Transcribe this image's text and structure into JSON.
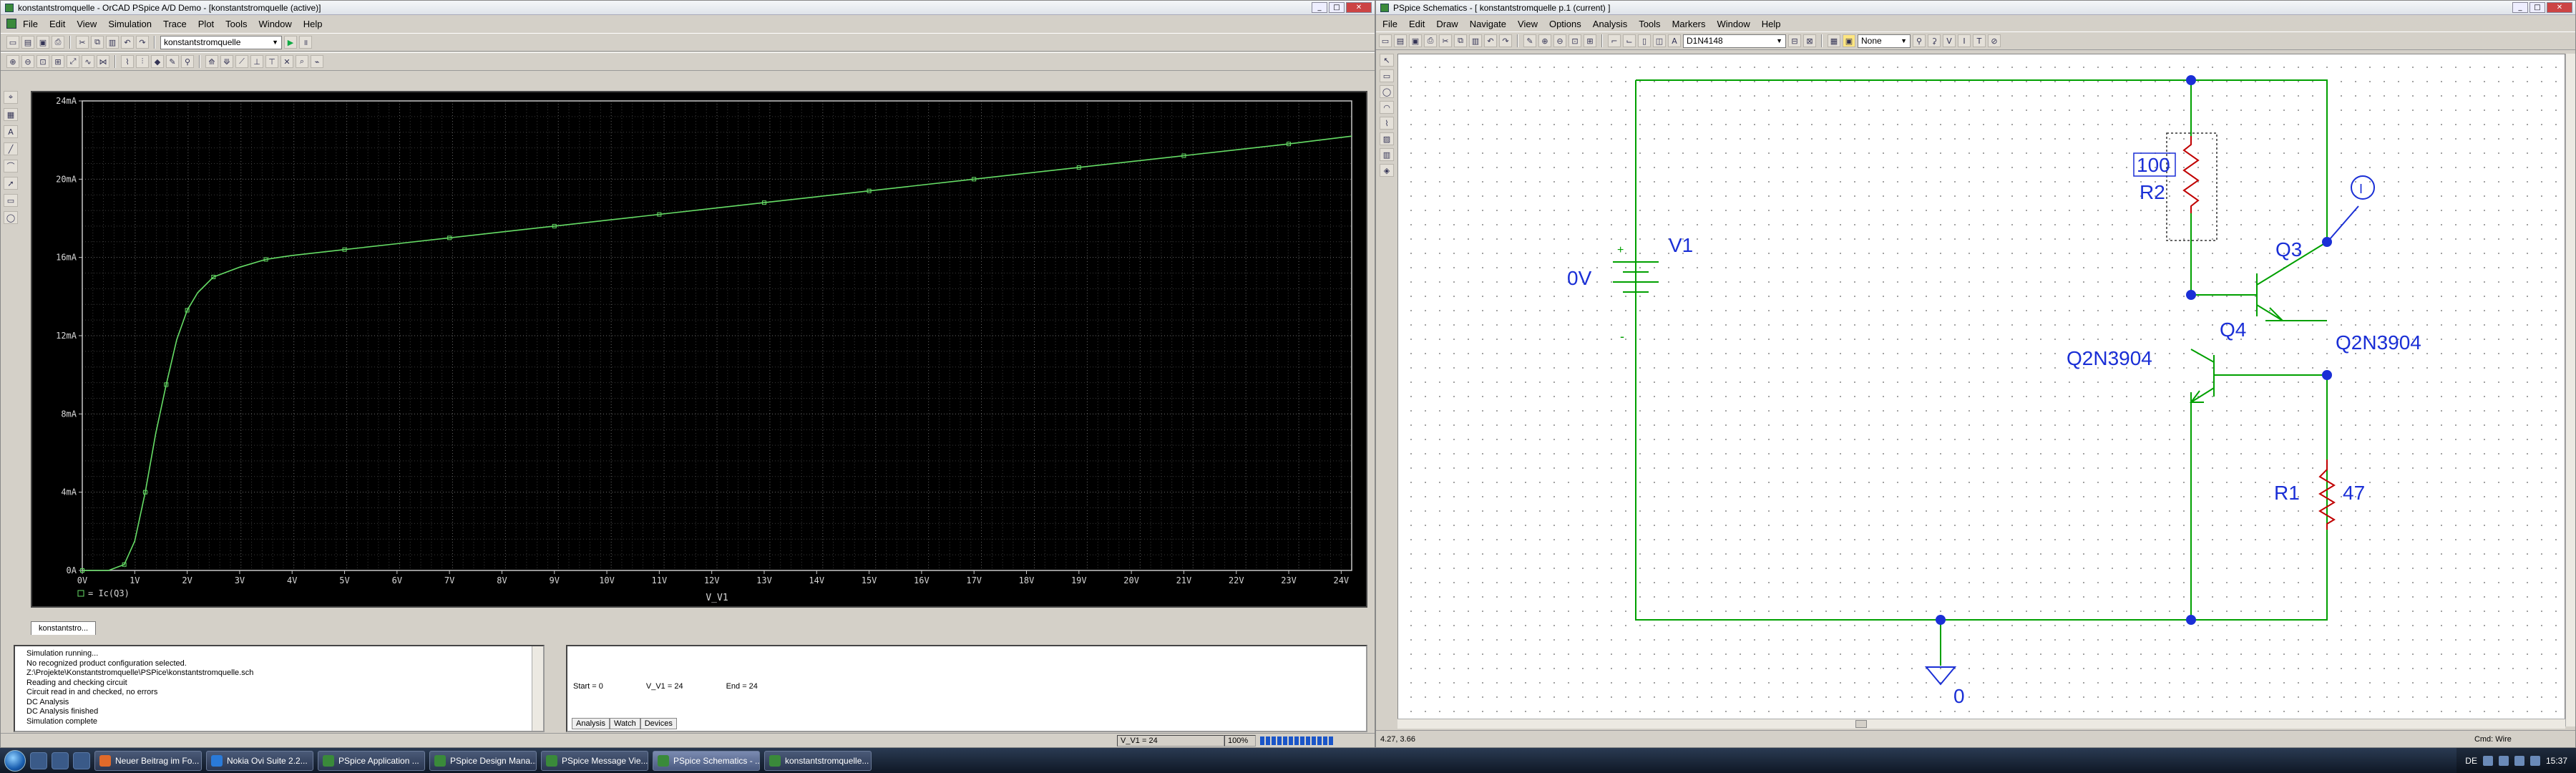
{
  "probe": {
    "title": "konstantstromquelle - OrCAD PSpice A/D Demo - [konstantstromquelle (active)]",
    "menu": [
      "File",
      "Edit",
      "View",
      "Simulation",
      "Trace",
      "Plot",
      "Tools",
      "Window",
      "Help"
    ],
    "profile_value": "konstantstromquelle",
    "doc_tab": "konstantstro...",
    "output_lines": [
      "Simulation running...",
      "No recognized product configuration selected.",
      "Z:\\Projekte\\Konstantstromquelle\\PSPice\\konstantstromquelle.sch",
      "Reading and checking circuit",
      "Circuit read in and checked, no errors",
      "DC Analysis",
      "DC Analysis finished",
      "Simulation complete"
    ],
    "sim": {
      "start": "Start = 0",
      "var": "V_V1 = 24",
      "end": "End = 24"
    },
    "sim_tabs": [
      "Analysis",
      "Watch",
      "Devices"
    ],
    "status_var": "V_V1 = 24",
    "status_zoom": "100%"
  },
  "chart_data": {
    "type": "line",
    "title": "",
    "xlabel": "V_V1",
    "ylabel": "",
    "x_tick_labels": [
      "0V",
      "1V",
      "2V",
      "3V",
      "4V",
      "5V",
      "6V",
      "7V",
      "8V",
      "9V",
      "10V",
      "11V",
      "12V",
      "13V",
      "14V",
      "15V",
      "16V",
      "17V",
      "18V",
      "19V",
      "20V",
      "21V",
      "22V",
      "23V",
      "24V"
    ],
    "y_tick_labels": [
      "0A",
      "4mA",
      "8mA",
      "12mA",
      "16mA",
      "20mA",
      "24mA"
    ],
    "xlim": [
      0,
      24.2
    ],
    "ylim": [
      0,
      0.024
    ],
    "grid": true,
    "series": [
      {
        "name": "Ic(Q3)",
        "color": "#66dd66",
        "x": [
          0,
          0.5,
          0.8,
          1.0,
          1.2,
          1.4,
          1.6,
          1.8,
          2.0,
          2.2,
          2.5,
          3.0,
          3.5,
          4,
          5,
          6,
          7,
          8,
          9,
          10,
          11,
          12,
          13,
          14,
          15,
          16,
          17,
          18,
          19,
          20,
          21,
          22,
          23,
          24.2
        ],
        "y": [
          0,
          0,
          0.0003,
          0.0015,
          0.004,
          0.007,
          0.0095,
          0.0118,
          0.0133,
          0.0142,
          0.015,
          0.0155,
          0.0159,
          0.0161,
          0.0164,
          0.0167,
          0.017,
          0.0173,
          0.0176,
          0.0179,
          0.0182,
          0.0185,
          0.0188,
          0.0191,
          0.0194,
          0.0197,
          0.02,
          0.0203,
          0.0206,
          0.0209,
          0.0212,
          0.0215,
          0.0218,
          0.0222
        ]
      }
    ]
  },
  "schematic": {
    "title": "PSpice Schematics - [ konstantstromquelle p.1 (current) ]",
    "menu": [
      "File",
      "Edit",
      "Draw",
      "Navigate",
      "View",
      "Options",
      "Analysis",
      "Tools",
      "Markers",
      "Window",
      "Help"
    ],
    "part_combo": "D1N4148",
    "attr_combo": "None",
    "labels": {
      "v1_value": "0V",
      "v1_name": "V1",
      "r2_value": "100",
      "r2_name": "R2",
      "q3_name": "Q3",
      "q3_model": "Q2N3904",
      "q4_name": "Q4",
      "q4_model": "Q2N3904",
      "r1_name": "R1",
      "r1_value": "47",
      "ground": "0",
      "plus": "+",
      "minus": "-",
      "probe_mark": "I"
    },
    "status_coords": "4.27, 3.66",
    "status_cmd": "Cmd: Wire"
  },
  "taskbar": {
    "tasks": [
      "Neuer Beitrag im Fo...",
      "Nokia Ovi Suite 2.2...",
      "PSpice Application ...",
      "PSpice Design Mana...",
      "PSpice Message Vie...",
      "PSpice Schematics - ...",
      "konstantstromquelle..."
    ],
    "lang": "DE",
    "clock": "15:37"
  }
}
